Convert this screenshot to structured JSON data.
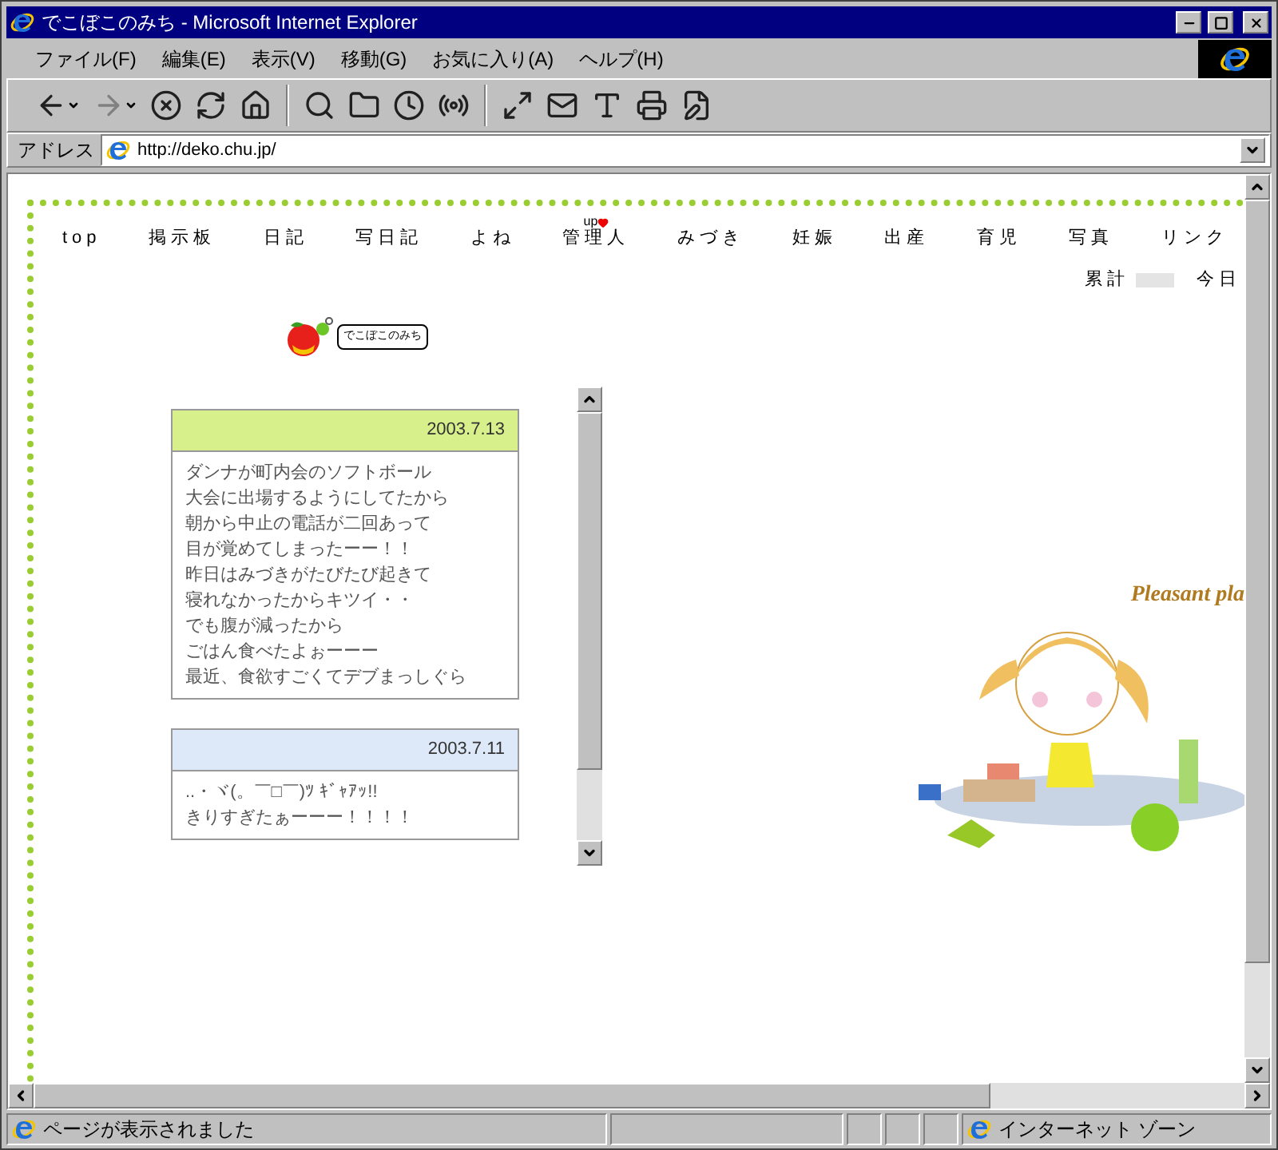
{
  "window": {
    "title": "でこぼこのみち - Microsoft Internet Explorer"
  },
  "menu": [
    "ファイル(F)",
    "編集(E)",
    "表示(V)",
    "移動(G)",
    "お気に入り(A)",
    "ヘルプ(H)"
  ],
  "address": {
    "label": "アドレス",
    "url": "http://deko.chu.jp/"
  },
  "nav": [
    {
      "label": "top"
    },
    {
      "label": "掲示板"
    },
    {
      "label": "日記"
    },
    {
      "label": "写日記"
    },
    {
      "label": "よね"
    },
    {
      "label": "管理人",
      "badge": "up"
    },
    {
      "label": "みづき"
    },
    {
      "label": "妊娠"
    },
    {
      "label": "出産"
    },
    {
      "label": "育児"
    },
    {
      "label": "写真"
    },
    {
      "label": "リンク"
    }
  ],
  "counter": {
    "total_label": "累計",
    "today_label": "今日"
  },
  "logo": {
    "text": "でこぼこのみち"
  },
  "diary": [
    {
      "date": "2003.7.13",
      "color": "#d8f08c",
      "lines": [
        "ダンナが町内会のソフトボール",
        "大会に出場するようにしてたから",
        "朝から中止の電話が二回あって",
        "目が覚めてしまったーー！！",
        "昨日はみづきがたびたび起きて",
        "寝れなかったからキツイ・・",
        "でも腹が減ったから",
        "ごはん食べたよぉーーー",
        "最近、食欲すごくてデブまっしぐら"
      ]
    },
    {
      "date": "2003.7.11",
      "color": "#dde9f8",
      "lines": [
        "..・ヾ(。￣□￣)ﾂ ｷﾞｬｱｯ!!",
        "きりすぎたぁーーー！！！！"
      ]
    }
  ],
  "illustration": {
    "caption": "Pleasant pla"
  },
  "status_bar": {
    "text": "ページが表示されました",
    "zone": "インターネット ゾーン"
  }
}
